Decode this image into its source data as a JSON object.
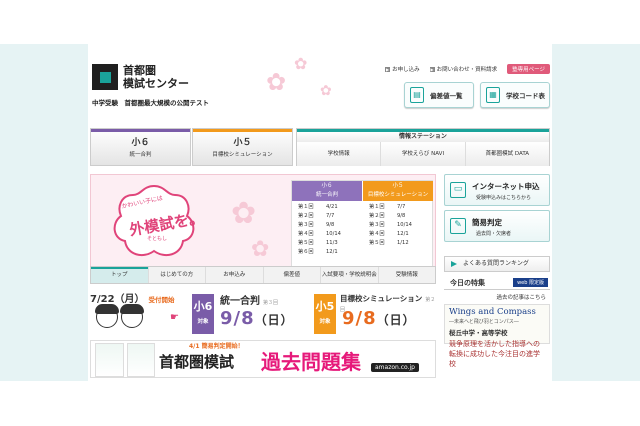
{
  "logo": {
    "line1": "首都圏",
    "line2": "模試センター"
  },
  "tagline": "中学受験　首都圏最大規模の公開テスト",
  "toplinks": {
    "apply": "お申し込み",
    "contact": "お問い合わせ・資料請求",
    "recruit": "塾専用ページ"
  },
  "topbuttons": {
    "deviation": "偏差値一覧",
    "school_code": "学校コード表"
  },
  "nav": {
    "grade6": {
      "title": "小６",
      "sub": "統一合判"
    },
    "grade5": {
      "title": "小５",
      "sub": "目標校シミュレーション"
    },
    "info": {
      "title": "情報ステーション",
      "items": [
        "学校情報",
        "学校えらび NAVI",
        "首都圏模試 DATA"
      ]
    }
  },
  "hero": {
    "badge_top": "かわいい子には",
    "badge_main": "外模試を。",
    "badge_ruby": "そともし",
    "g6": {
      "title": "小６",
      "sub": "統一合判",
      "rows": [
        [
          "第１回",
          "4/21"
        ],
        [
          "第２回",
          "7/7"
        ],
        [
          "第３回",
          "9/8"
        ],
        [
          "第４回",
          "10/14"
        ],
        [
          "第５回",
          "11/3"
        ],
        [
          "第６回",
          "12/1"
        ]
      ]
    },
    "g5": {
      "title": "小５",
      "sub": "目標校シミュレーション",
      "rows": [
        [
          "第１回",
          "7/7"
        ],
        [
          "第２回",
          "9/8"
        ],
        [
          "第３回",
          "10/14"
        ],
        [
          "第４回",
          "12/1"
        ],
        [
          "第５回",
          "1/12"
        ]
      ]
    }
  },
  "subnav": [
    "トップ",
    "はじめての方",
    "お申込み",
    "偏差値",
    "入試要項・学校説明会",
    "受験情報"
  ],
  "exam": {
    "date": "7/22（月）",
    "start": "受付開始",
    "g6": {
      "num": "小6",
      "target": "対象",
      "name": "統一合判",
      "round": "第３回",
      "date": "9/8",
      "dow": "（日）"
    },
    "g5": {
      "num": "小5",
      "target": "対象",
      "name": "目標校シミュレーション",
      "round": "第２回",
      "date": "9/8",
      "dow": "（日）"
    }
  },
  "past": {
    "note": "4/1 簡易判定開始！",
    "title1": "首都圏模試",
    "title2": "過去問題集",
    "amazon": "amazon.co.jp"
  },
  "side": {
    "internet": {
      "title": "インターネット申込",
      "sub": "受験申込みはこちらから"
    },
    "simple": {
      "title": "簡易判定",
      "sub": "過去問・欠席者"
    },
    "faq": "よくある質問ランキング",
    "today": "今日の特集",
    "web": "web 限定版",
    "archive": "過去の記事はこちら",
    "wings": {
      "title": "Wings and Compass",
      "sub": "―未来へと飛び羽とコンパス―",
      "school": "桜丘中学・高等学校",
      "lead": "競争原理を活かした指導への転換に成功した今注目の進学校"
    }
  }
}
